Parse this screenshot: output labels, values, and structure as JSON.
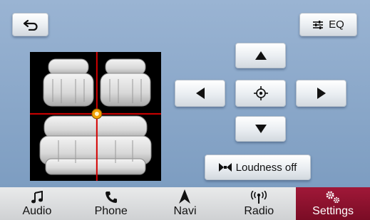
{
  "top": {
    "back_icon": "back-arrow-icon",
    "eq_icon": "sliders-icon",
    "eq_label": "EQ"
  },
  "balance": {
    "position": {
      "front_rear": 0.48,
      "left_right": 0.51
    },
    "colors": {
      "crosshair": "#d40000",
      "marker": "#f0a000"
    }
  },
  "controls": {
    "up_icon": "triangle-up-icon",
    "down_icon": "triangle-down-icon",
    "left_icon": "triangle-left-icon",
    "right_icon": "triangle-right-icon",
    "center_icon": "center-target-icon",
    "loudness_icon": "bowtie-icon",
    "loudness_label": "Loudness off"
  },
  "nav": {
    "items": [
      {
        "label": "Audio",
        "icon": "music-note-icon"
      },
      {
        "label": "Phone",
        "icon": "phone-icon"
      },
      {
        "label": "Navi",
        "icon": "navigation-arrow-icon"
      },
      {
        "label": "Radio",
        "icon": "radio-waves-icon"
      },
      {
        "label": "Settings",
        "icon": "gears-icon",
        "active": true
      }
    ],
    "active_color": "#8c1230"
  }
}
